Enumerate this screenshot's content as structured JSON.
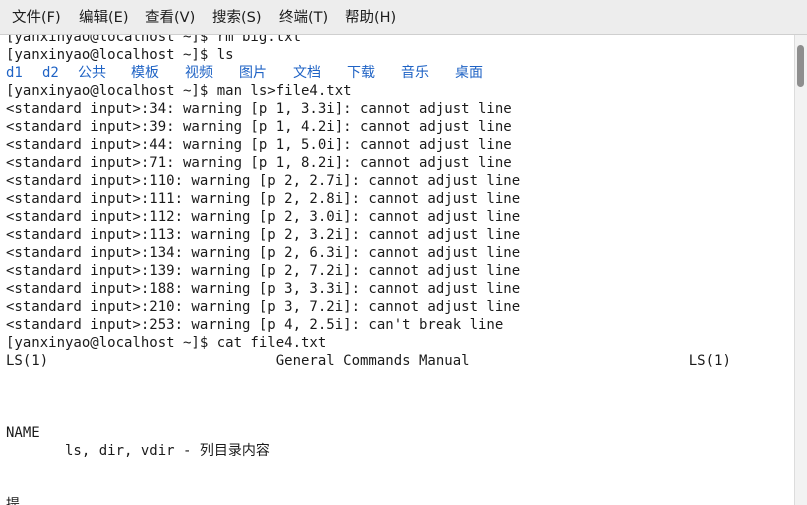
{
  "menubar": {
    "items": [
      {
        "label": "文件(F)"
      },
      {
        "label": "编辑(E)"
      },
      {
        "label": "查看(V)"
      },
      {
        "label": "搜索(S)"
      },
      {
        "label": "终端(T)"
      },
      {
        "label": "帮助(H)"
      }
    ]
  },
  "terminal": {
    "lines": [
      "[yanxinyao@localhost ~]$ rm big.txt",
      "[yanxinyao@localhost ~]$ ls",
      "",
      "[yanxinyao@localhost ~]$ man ls>file4.txt",
      "<standard input>:34: warning [p 1, 3.3i]: cannot adjust line",
      "<standard input>:39: warning [p 1, 4.2i]: cannot adjust line",
      "<standard input>:44: warning [p 1, 5.0i]: cannot adjust line",
      "<standard input>:71: warning [p 1, 8.2i]: cannot adjust line",
      "<standard input>:110: warning [p 2, 2.7i]: cannot adjust line",
      "<standard input>:111: warning [p 2, 2.8i]: cannot adjust line",
      "<standard input>:112: warning [p 2, 3.0i]: cannot adjust line",
      "<standard input>:113: warning [p 2, 3.2i]: cannot adjust line",
      "<standard input>:134: warning [p 2, 6.3i]: cannot adjust line",
      "<standard input>:139: warning [p 2, 7.2i]: cannot adjust line",
      "<standard input>:188: warning [p 3, 3.3i]: cannot adjust line",
      "<standard input>:210: warning [p 3, 7.2i]: cannot adjust line",
      "<standard input>:253: warning [p 4, 2.5i]: can't break line",
      "[yanxinyao@localhost ~]$ cat file4.txt",
      "LS(1)                           General Commands Manual                          LS(1)",
      "",
      "",
      "",
      "NAME",
      "       ls, dir, vdir - 列目录内容",
      "",
      "",
      "提"
    ],
    "ls_output": [
      "d1",
      "d2",
      "公共",
      "模板",
      "视频",
      "图片",
      "文档",
      "下载",
      "音乐",
      "桌面"
    ]
  },
  "colors": {
    "directory_listing": "#1f63c5",
    "menubar_bg": "#ededed"
  }
}
